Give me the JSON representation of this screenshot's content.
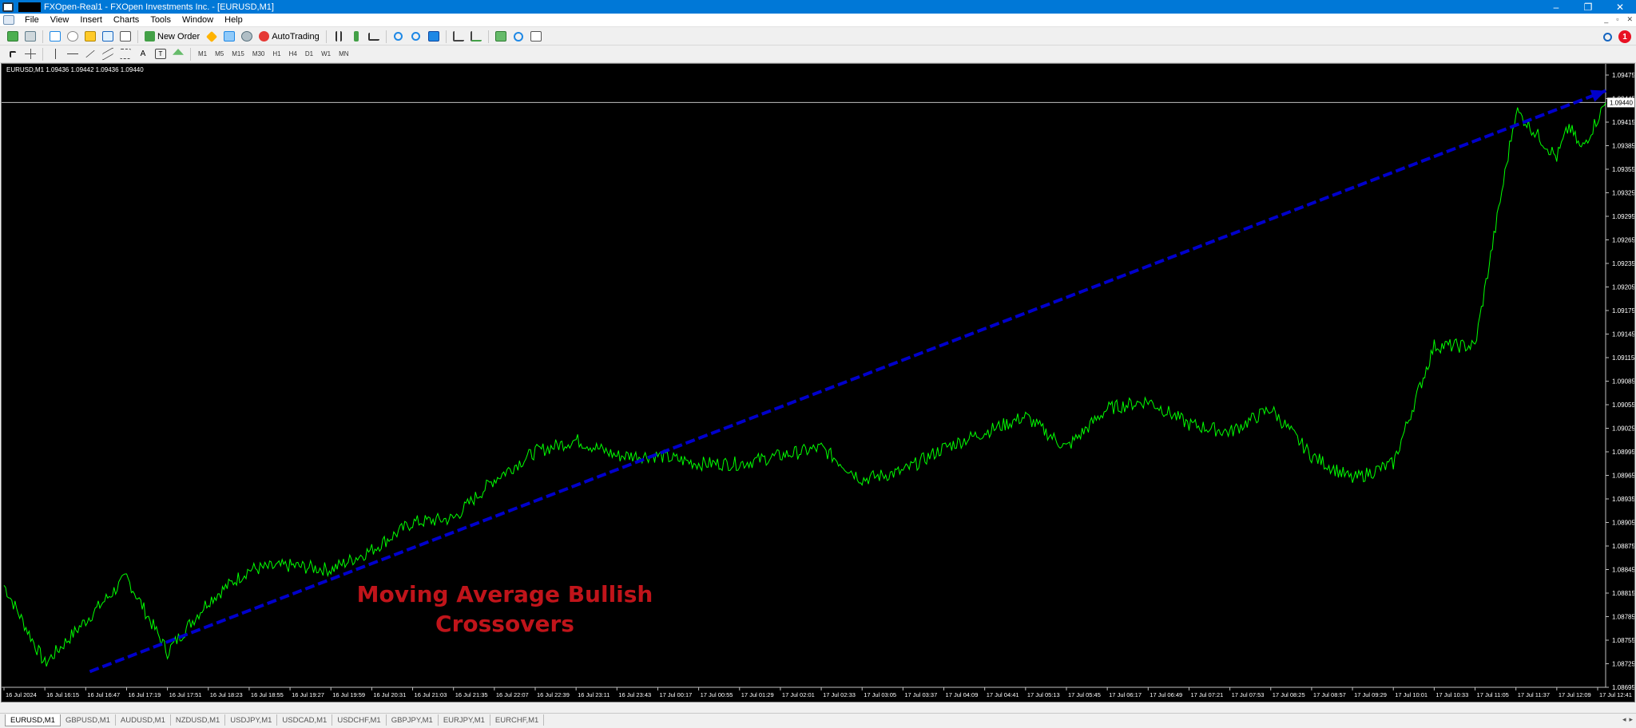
{
  "window": {
    "title": "FXOpen-Real1 - FXOpen Investments Inc. - [EURUSD,M1]",
    "controls": {
      "minimize": "–",
      "maximize": "❐",
      "close": "✕"
    }
  },
  "menu": {
    "items": [
      "File",
      "View",
      "Insert",
      "Charts",
      "Tools",
      "Window",
      "Help"
    ],
    "mdi": [
      "_",
      "▫",
      "✕"
    ]
  },
  "toolbar": {
    "new_order_label": "New Order",
    "autotrading_label": "AutoTrading",
    "notification_count": "1",
    "timeframes": [
      "M1",
      "M5",
      "M15",
      "M30",
      "H1",
      "H4",
      "D1",
      "W1",
      "MN"
    ]
  },
  "chart": {
    "symbol_header": "EURUSD,M1  1.09436 1.09442 1.09436 1.09440",
    "overlay_text_line1": "Moving Average Bullish",
    "overlay_text_line2": "Crossovers",
    "current_price_label": "1.09440",
    "colors": {
      "price_line": "#00ff00",
      "trend_line": "#0000cc",
      "overlay_text": "#c0141a",
      "background": "#000000"
    }
  },
  "chart_data": {
    "type": "line",
    "title": "EURUSD,M1",
    "ylim": [
      1.08695,
      1.09475
    ],
    "y_ticks": [
      "1.09475",
      "1.09445",
      "1.09415",
      "1.09385",
      "1.09355",
      "1.09325",
      "1.09295",
      "1.09265",
      "1.09235",
      "1.09205",
      "1.09175",
      "1.09145",
      "1.09115",
      "1.09085",
      "1.09055",
      "1.09025",
      "1.08995",
      "1.08965",
      "1.08935",
      "1.08905",
      "1.08875",
      "1.08845",
      "1.08815",
      "1.08785",
      "1.08755",
      "1.08725",
      "1.08695"
    ],
    "x_ticks": [
      "16 Jul 2024",
      "16 Jul 16:15",
      "16 Jul 16:47",
      "16 Jul 17:19",
      "16 Jul 17:51",
      "16 Jul 18:23",
      "16 Jul 18:55",
      "16 Jul 19:27",
      "16 Jul 19:59",
      "16 Jul 20:31",
      "16 Jul 21:03",
      "16 Jul 21:35",
      "16 Jul 22:07",
      "16 Jul 22:39",
      "16 Jul 23:11",
      "16 Jul 23:43",
      "17 Jul 00:17",
      "17 Jul 00:55",
      "17 Jul 01:29",
      "17 Jul 02:01",
      "17 Jul 02:33",
      "17 Jul 03:05",
      "17 Jul 03:37",
      "17 Jul 04:09",
      "17 Jul 04:41",
      "17 Jul 05:13",
      "17 Jul 05:45",
      "17 Jul 06:17",
      "17 Jul 06:49",
      "17 Jul 07:21",
      "17 Jul 07:53",
      "17 Jul 08:25",
      "17 Jul 08:57",
      "17 Jul 09:29",
      "17 Jul 10:01",
      "17 Jul 10:33",
      "17 Jul 11:05",
      "17 Jul 11:37",
      "17 Jul 12:09",
      "17 Jul 12:41"
    ],
    "current_price": 1.0944,
    "series": [
      {
        "name": "EURUSD,M1",
        "x": [
          0,
          1,
          2,
          3,
          4,
          5,
          6,
          7,
          8,
          9,
          10,
          11,
          12,
          13,
          14,
          15,
          16,
          17,
          18,
          19,
          20,
          21,
          22,
          23,
          24,
          25,
          26,
          27,
          28,
          29,
          30,
          31,
          32,
          33,
          34,
          35,
          36,
          37,
          38,
          38.3,
          38.6,
          39,
          39.2
        ],
        "y": [
          1.08825,
          1.08725,
          1.0878,
          1.08835,
          1.0874,
          1.08805,
          1.08845,
          1.0885,
          1.08845,
          1.0887,
          1.08905,
          1.0891,
          1.0896,
          1.08995,
          1.0901,
          1.0899,
          1.0899,
          1.0898,
          1.0898,
          1.0899,
          1.09,
          1.0896,
          1.0897,
          1.09,
          1.0902,
          1.0904,
          1.09,
          1.0905,
          1.0906,
          1.0903,
          1.0902,
          1.0905,
          1.0899,
          1.0896,
          1.0898,
          1.0913,
          1.0913,
          1.0943,
          1.0937,
          1.0941,
          1.0938,
          1.0942,
          1.0944
        ]
      },
      {
        "name": "Trend line",
        "x": [
          2.1,
          39.2
        ],
        "y": [
          1.08715,
          1.09455
        ]
      }
    ]
  },
  "tabs": [
    "EURUSD,M1",
    "GBPUSD,M1",
    "AUDUSD,M1",
    "NZDUSD,M1",
    "USDJPY,M1",
    "USDCAD,M1",
    "USDCHF,M1",
    "GBPJPY,M1",
    "EURJPY,M1",
    "EURCHF,M1"
  ],
  "tab_scroll": [
    "◂",
    "▸"
  ]
}
